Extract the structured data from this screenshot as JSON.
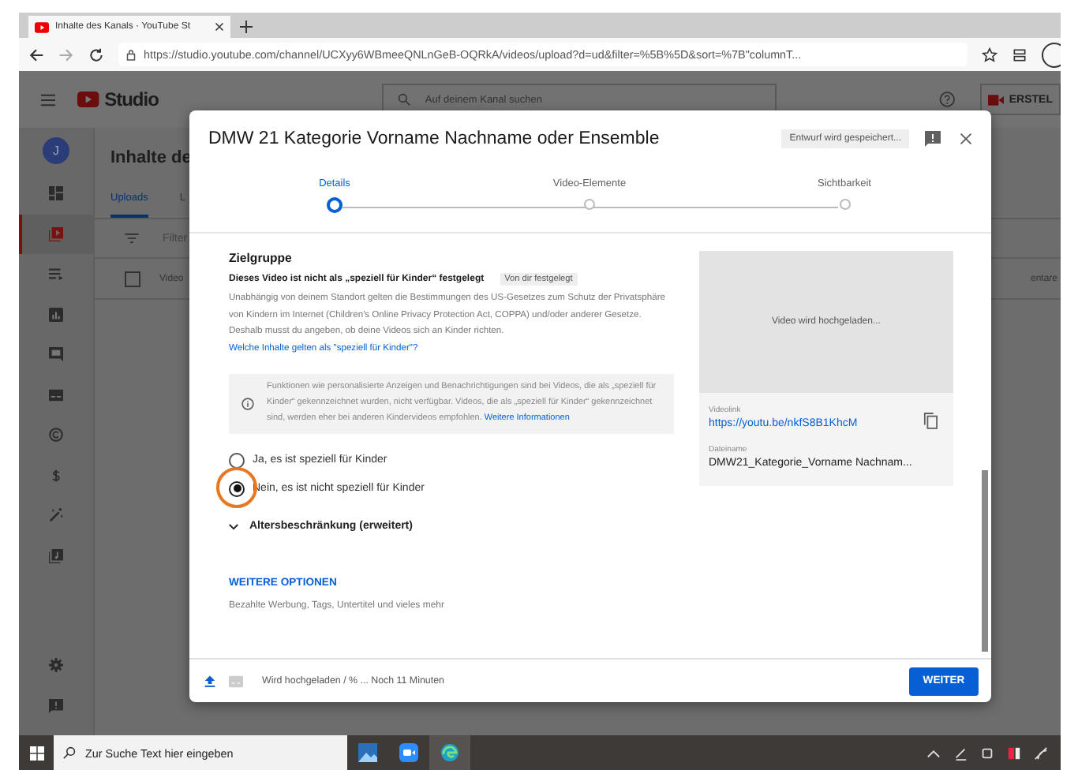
{
  "browser": {
    "tab_title": "Inhalte des Kanals · YouTube St",
    "url": "https://studio.youtube.com/channel/UCXyy6WBmeeQNLnGeB-OQRkA/videos/upload?d=ud&filter=%5B%5D&sort=%7B\"columnT..."
  },
  "header": {
    "logo": "Studio",
    "search_placeholder": "Auf deinem Kanal suchen",
    "create_label": "ERSTEL"
  },
  "sidebar": {
    "avatar": "J",
    "items": [
      {
        "kind": "dashboard",
        "selected": false
      },
      {
        "kind": "content",
        "selected": true
      },
      {
        "kind": "playlists",
        "selected": false
      },
      {
        "kind": "analytics",
        "selected": false
      },
      {
        "kind": "comments",
        "selected": false
      },
      {
        "kind": "subtitles",
        "selected": false
      },
      {
        "kind": "copyright",
        "selected": false
      },
      {
        "kind": "earn",
        "selected": false
      },
      {
        "kind": "customize",
        "selected": false
      },
      {
        "kind": "audio",
        "selected": false
      }
    ],
    "bottom_items": [
      {
        "kind": "settings"
      },
      {
        "kind": "feedback"
      }
    ]
  },
  "content": {
    "title": "Inhalte de",
    "tabs": [
      {
        "label": "Uploads",
        "selected": true
      },
      {
        "label": "L",
        "selected": false
      }
    ],
    "filter": "Filter",
    "select_all": {
      "checked": false
    },
    "columns": [
      "Video",
      "entare"
    ]
  },
  "dialog": {
    "title": "DMW 21 Kategorie Vorname Nachname oder Ensemble",
    "draft_status": "Entwurf wird gespeichert...",
    "steps": [
      {
        "label": "Details",
        "selected": true
      },
      {
        "label": "Video-Elemente",
        "selected": false
      },
      {
        "label": "Sichtbarkeit",
        "selected": false
      }
    ],
    "audience": {
      "heading": "Zielgruppe",
      "status": "Dieses Video ist nicht als „speziell für Kinder“ festgelegt",
      "status_chip": "Von dir festgelegt",
      "description": "Unabhängig von deinem Standort gelten die Bestimmungen des US-Gesetzes zum Schutz der Privatsphäre von Kindern im Internet (Children's Online Privacy Protection Act, COPPA) und/oder anderer Gesetze. Deshalb musst du angeben, ob deine Videos sich an Kinder richten.",
      "description_link": "Welche Inhalte gelten als \"speziell für Kinder\"?",
      "info": "Funktionen wie personalisierte Anzeigen und Benachrichtigungen sind bei Videos, die als „speziell für Kinder“ gekennzeichnet wurden, nicht verfügbar. Videos, die als „speziell für Kinder“ gekennzeichnet sind, werden eher bei anderen Kindervideos empfohlen.",
      "info_link": "Weitere Informationen",
      "options": [
        {
          "label": "Ja, es ist speziell für Kinder",
          "selected": false,
          "highlighted": false
        },
        {
          "label": "Nein, es ist nicht speziell für Kinder",
          "selected": true,
          "highlighted": true
        }
      ]
    },
    "age_restriction": {
      "label": "Altersbeschränkung (erweitert)",
      "expanded": false
    },
    "more_options": {
      "label": "WEITERE OPTIONEN",
      "description": "Bezahlte Werbung, Tags, Untertitel und vieles mehr"
    },
    "preview": {
      "status": "Video wird hochgeladen...",
      "link_label": "Videolink",
      "link": "https://youtu.be/nkfS8B1KhcM",
      "file_label": "Dateiname",
      "file_name": "DMW21_Kategorie_Vorname Nachnam..."
    },
    "footer": {
      "progress": "Wird hochgeladen / % ... Noch 11 Minuten",
      "next": "WEITER"
    }
  },
  "taskbar": {
    "search_placeholder": "Zur Suche Text hier eingeben"
  }
}
